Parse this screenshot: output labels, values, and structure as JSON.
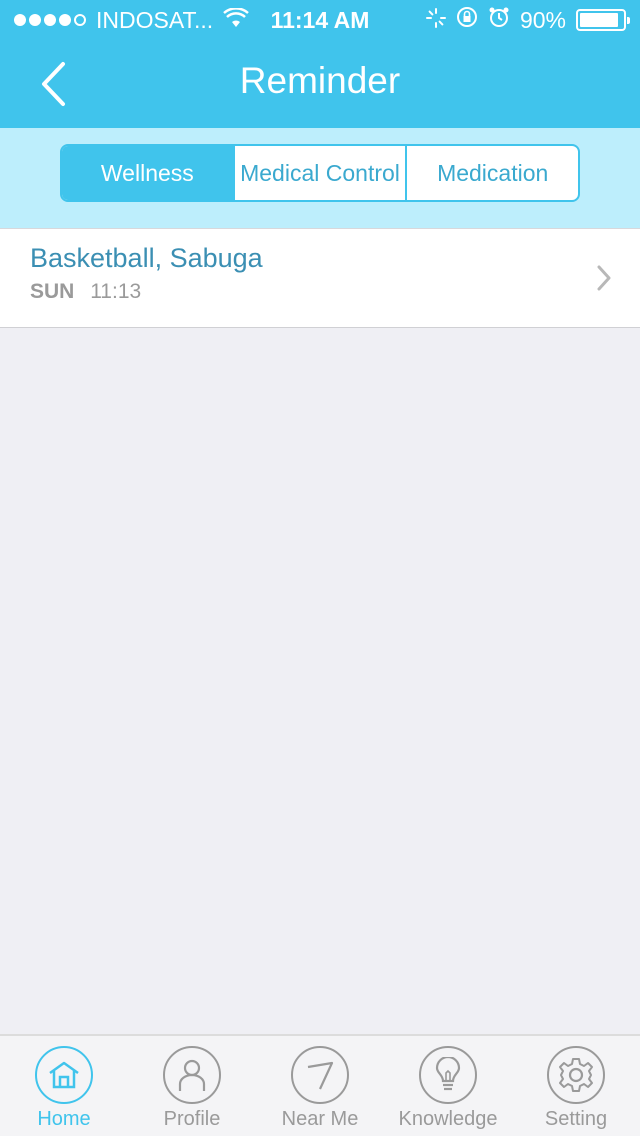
{
  "status_bar": {
    "carrier": "INDOSAT...",
    "time": "11:14 AM",
    "battery": "90%",
    "battery_level": 0.9
  },
  "nav": {
    "title": "Reminder",
    "back_icon": "chevron-left-icon"
  },
  "segments": [
    {
      "label": "Wellness",
      "active": true
    },
    {
      "label": "Medical Control",
      "active": false
    },
    {
      "label": "Medication",
      "active": false
    }
  ],
  "reminders": [
    {
      "title": "Basketball, Sabuga",
      "day": "SUN",
      "time": "11:13"
    }
  ],
  "tabs": [
    {
      "label": "Home",
      "icon": "home-icon",
      "active": true
    },
    {
      "label": "Profile",
      "icon": "profile-icon",
      "active": false
    },
    {
      "label": "Near Me",
      "icon": "compass-icon",
      "active": false
    },
    {
      "label": "Knowledge",
      "icon": "lightbulb-icon",
      "active": false
    },
    {
      "label": "Setting",
      "icon": "gear-icon",
      "active": false
    }
  ],
  "colors": {
    "accent": "#40c4ec",
    "segment_band": "#bdeefc",
    "item_title": "#3b8fb3",
    "background": "#efeff4"
  }
}
